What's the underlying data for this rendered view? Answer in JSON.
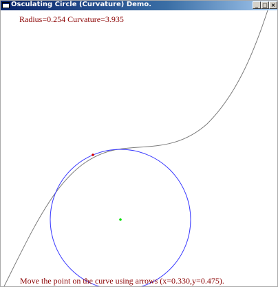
{
  "window": {
    "title": "Osculating Circle (Curvature) Demo.",
    "buttons": {
      "minimize": "_",
      "maximize": "□",
      "close": "×"
    }
  },
  "readout": {
    "radius_curvature": "Radius=0.254 Curvature=3.935",
    "instruction": "Move the point on the curve using arrows (x=0.330,y=0.475)."
  },
  "colors": {
    "curve": "#7a7a7a",
    "circle": "#3b3bff",
    "point": "#d40000",
    "center": "#00e000",
    "text": "#8b0000"
  }
}
